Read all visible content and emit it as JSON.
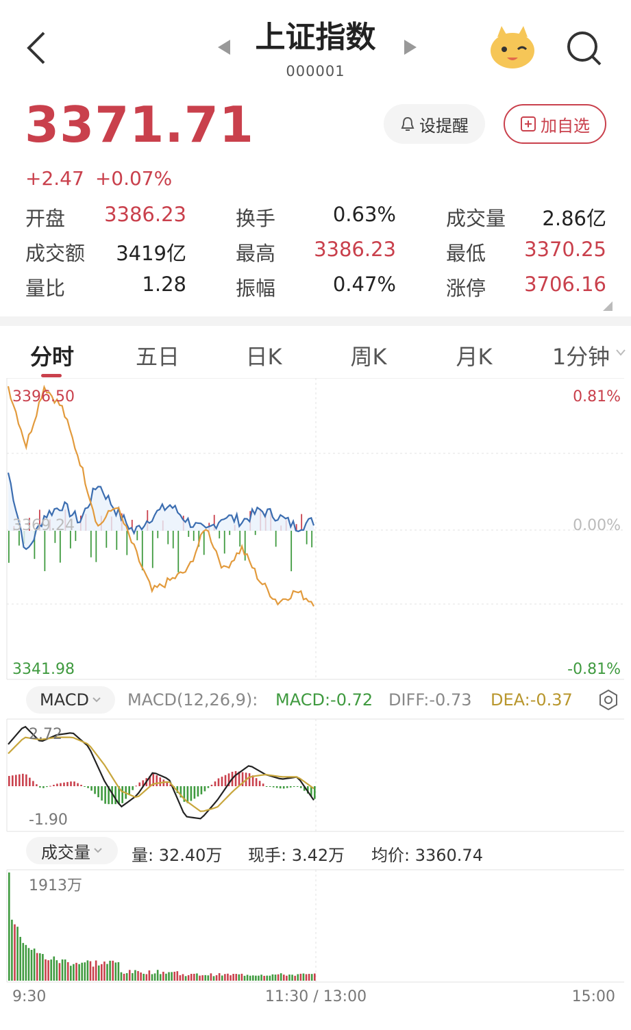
{
  "header": {
    "title": "上证指数",
    "code": "000001"
  },
  "quote": {
    "price": "3371.71",
    "change": "+2.47",
    "change_pct": "+0.07%",
    "alert_label": "设提醒",
    "fav_label": "加自选"
  },
  "stats": [
    {
      "label": "开盘",
      "value": "3386.23",
      "color": "red"
    },
    {
      "label": "换手",
      "value": "0.63%",
      "color": "dark"
    },
    {
      "label": "成交量",
      "value": "2.86亿",
      "color": "dark"
    },
    {
      "label": "成交额",
      "value": "3419亿",
      "color": "dark"
    },
    {
      "label": "最高",
      "value": "3386.23",
      "color": "red"
    },
    {
      "label": "最低",
      "value": "3370.25",
      "color": "red"
    },
    {
      "label": "量比",
      "value": "1.28",
      "color": "dark"
    },
    {
      "label": "振幅",
      "value": "0.47%",
      "color": "dark"
    },
    {
      "label": "涨停",
      "value": "3706.16",
      "color": "red"
    }
  ],
  "tabs": [
    "分时",
    "五日",
    "日K",
    "周K",
    "月K",
    "1分钟"
  ],
  "intraday": {
    "price_high": "3396.50",
    "price_mid": "3369.24",
    "price_low": "3341.98",
    "pct_high": "0.81%",
    "pct_mid": "0.00%",
    "pct_low": "-0.81%"
  },
  "macd": {
    "chip": "MACD",
    "params": "MACD(12,26,9):",
    "macd": "MACD:-0.72",
    "diff": "DIFF:-0.73",
    "dea": "DEA:-0.37",
    "axis_high": "2.72",
    "axis_low": "-1.90"
  },
  "volume": {
    "chip": "成交量",
    "vol": "量: 32.40万",
    "hand": "现手: 3.42万",
    "avg": "均价: 3360.74",
    "axis_high": "1913万"
  },
  "time_axis": [
    "9:30",
    "11:30 / 13:00",
    "15:00"
  ],
  "chart_data": {
    "type": "line",
    "series": [
      {
        "name": "",
        "values": [
          3380,
          3365,
          3372,
          3374,
          3371,
          3378,
          3373,
          3369,
          3372,
          3374,
          3371,
          3369,
          3372,
          3371,
          3373,
          3372,
          3370,
          3371
        ]
      },
      {
        "name": "",
        "values": [
          3396,
          3385,
          3396,
          3392,
          3382,
          3370,
          3374,
          3366,
          3358,
          3360,
          3362,
          3370,
          3362,
          3366,
          3360,
          3356,
          3358,
          3356
        ]
      }
    ],
    "ylim": [
      3341.98,
      3396.5
    ]
  },
  "colors": {
    "up": "#c9404c",
    "down": "#3f9a3f",
    "price_line": "#3b6db0",
    "avg_line": "#e29a3c"
  }
}
